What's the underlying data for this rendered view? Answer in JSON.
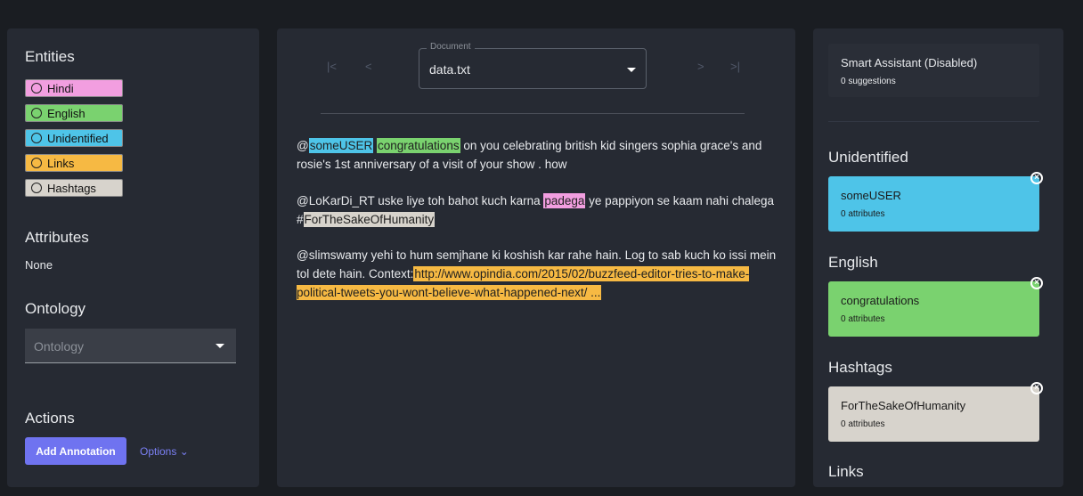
{
  "left": {
    "entities_title": "Entities",
    "entities": [
      {
        "label": "Hindi",
        "color": "#f29ee0"
      },
      {
        "label": "English",
        "color": "#7ad26f"
      },
      {
        "label": "Unidentified",
        "color": "#4ec4e8"
      },
      {
        "label": "Links",
        "color": "#f6b943"
      },
      {
        "label": "Hashtags",
        "color": "#d7d3cc"
      }
    ],
    "attributes_title": "Attributes",
    "attributes_value": "None",
    "ontology_title": "Ontology",
    "ontology_placeholder": "Ontology",
    "actions_title": "Actions",
    "add_annotation_label": "Add Annotation",
    "options_label": "Options ⌄"
  },
  "mid": {
    "nav_first": "|<",
    "nav_prev": "<",
    "nav_next": ">",
    "nav_last": ">|",
    "document_label": "Document",
    "document_value": "data.txt",
    "p1": {
      "t0": "@",
      "h1": "someUSER",
      "t1": " ",
      "h2": "congratulations",
      "t2": " on you celebrating british kid singers sophia grace's and rosie's 1st anniversary of a visit of your show .  how"
    },
    "p2": {
      "t0": "@LoKarDi_RT uske liye toh bahot kuch karna ",
      "h1": "padega",
      "t1": " ye pappiyon se kaam nahi chalega #",
      "h2": "ForTheSakeOfHumanity"
    },
    "p3": {
      "t0": "@slimswamy yehi to hum semjhane ki koshish kar rahe hain. Log to sab kuch ko issi mein tol dete hain. Context:",
      "h1": "http://www.opindia.com/2015/02/buzzfeed-editor-tries-to-make-political-tweets-you-wont-believe-what-happened-next/ ..."
    }
  },
  "right": {
    "assistant_title": "Smart Assistant (Disabled)",
    "assistant_sub": "0 suggestions",
    "groups": [
      {
        "heading": "Unidentified",
        "item": "someUSER",
        "attrs": "0 attributes",
        "color": "#4ec4e8"
      },
      {
        "heading": "English",
        "item": "congratulations",
        "attrs": "0 attributes",
        "color": "#7ad26f"
      },
      {
        "heading": "Hashtags",
        "item": "ForTheSakeOfHumanity",
        "attrs": "0 attributes",
        "color": "#d7d3cc"
      }
    ],
    "cut_heading": "Links",
    "close_glyph": "×"
  }
}
